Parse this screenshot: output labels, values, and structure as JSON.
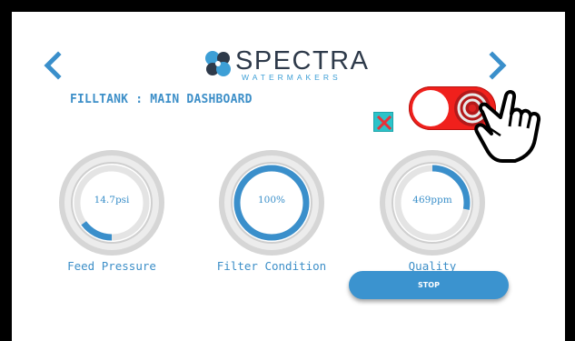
{
  "header": {
    "brand_name": "SPECTRA",
    "brand_sub": "WATERMAKERS",
    "page_title": "FILLTANK : MAIN DASHBOARD",
    "prev_icon": "chevron-left-icon",
    "next_icon": "chevron-right-icon"
  },
  "controls": {
    "close_icon": "close-x-icon",
    "toggle_state": "on",
    "toggle_color": "#f0201c",
    "pointer_icon": "pointing-hand-icon"
  },
  "gauges": [
    {
      "label": "Feed Pressure",
      "value": "14.7psi",
      "fill_fraction": 0.15
    },
    {
      "label": "Filter Condition",
      "value": "100%",
      "fill_fraction": 1.0
    },
    {
      "label": "Quality",
      "value": "469ppm",
      "fill_fraction": 0.28
    }
  ],
  "actions": {
    "stop_label": "STOP"
  },
  "colors": {
    "accent": "#3b93cf",
    "text_blue": "#3d8fc8",
    "close_bg": "#2bc3c9",
    "close_x": "#e8323a",
    "frame": "#000000"
  }
}
